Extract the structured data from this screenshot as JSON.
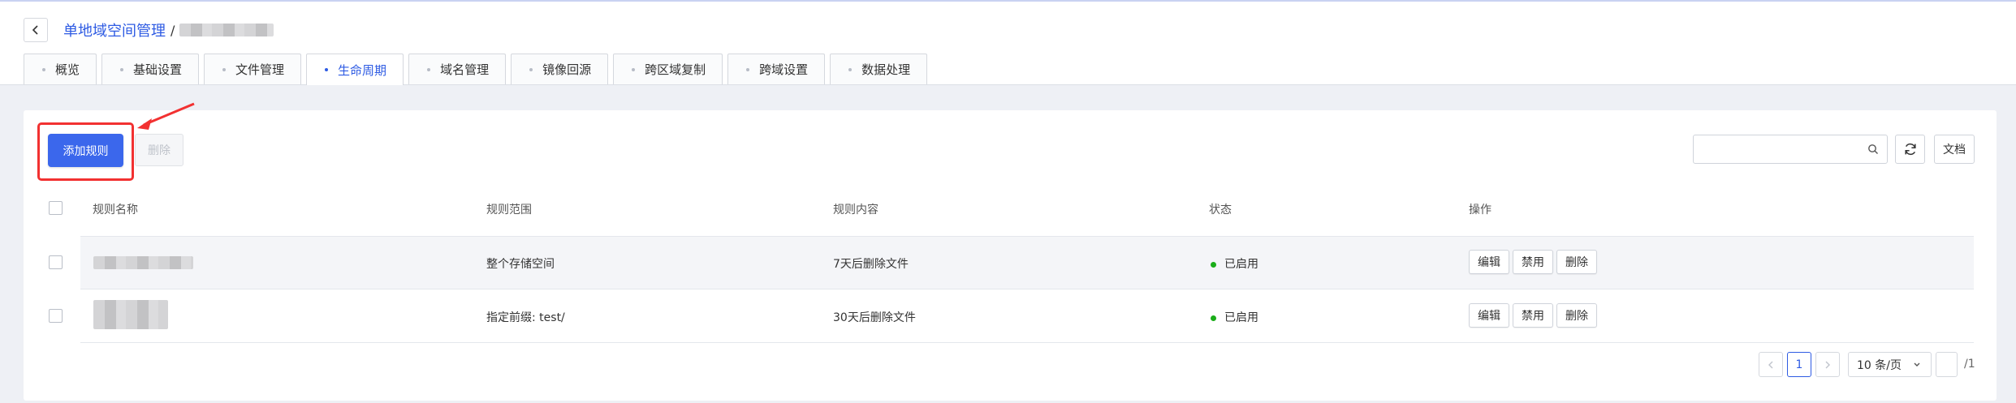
{
  "header": {
    "breadcrumb_root": "单地域空间管理",
    "breadcrumb_sep": "/"
  },
  "tabs": [
    {
      "label": "概览",
      "active": false
    },
    {
      "label": "基础设置",
      "active": false
    },
    {
      "label": "文件管理",
      "active": false
    },
    {
      "label": "生命周期",
      "active": true
    },
    {
      "label": "域名管理",
      "active": false
    },
    {
      "label": "镜像回源",
      "active": false
    },
    {
      "label": "跨区域复制",
      "active": false
    },
    {
      "label": "跨域设置",
      "active": false
    },
    {
      "label": "数据处理",
      "active": false
    }
  ],
  "toolbar": {
    "add_rule_label": "添加规则",
    "delete_label": "删除",
    "search_placeholder": "",
    "docs_label": "文档"
  },
  "table": {
    "columns": [
      "规则名称",
      "规则范围",
      "规则内容",
      "状态",
      "操作"
    ],
    "rows": [
      {
        "scope": "整个存储空间",
        "content": "7天后删除文件",
        "status": "已启用",
        "actions": [
          "编辑",
          "禁用",
          "删除"
        ]
      },
      {
        "scope": "指定前缀: test/",
        "content": "30天后删除文件",
        "status": "已启用",
        "actions": [
          "编辑",
          "禁用",
          "删除"
        ]
      }
    ]
  },
  "pagination": {
    "current_page": "1",
    "page_size": "10 条/页",
    "total_pages": "/1"
  },
  "colors": {
    "primary": "#3b67ec",
    "annotation_red": "#f23131",
    "status_green": "#1aad19"
  }
}
